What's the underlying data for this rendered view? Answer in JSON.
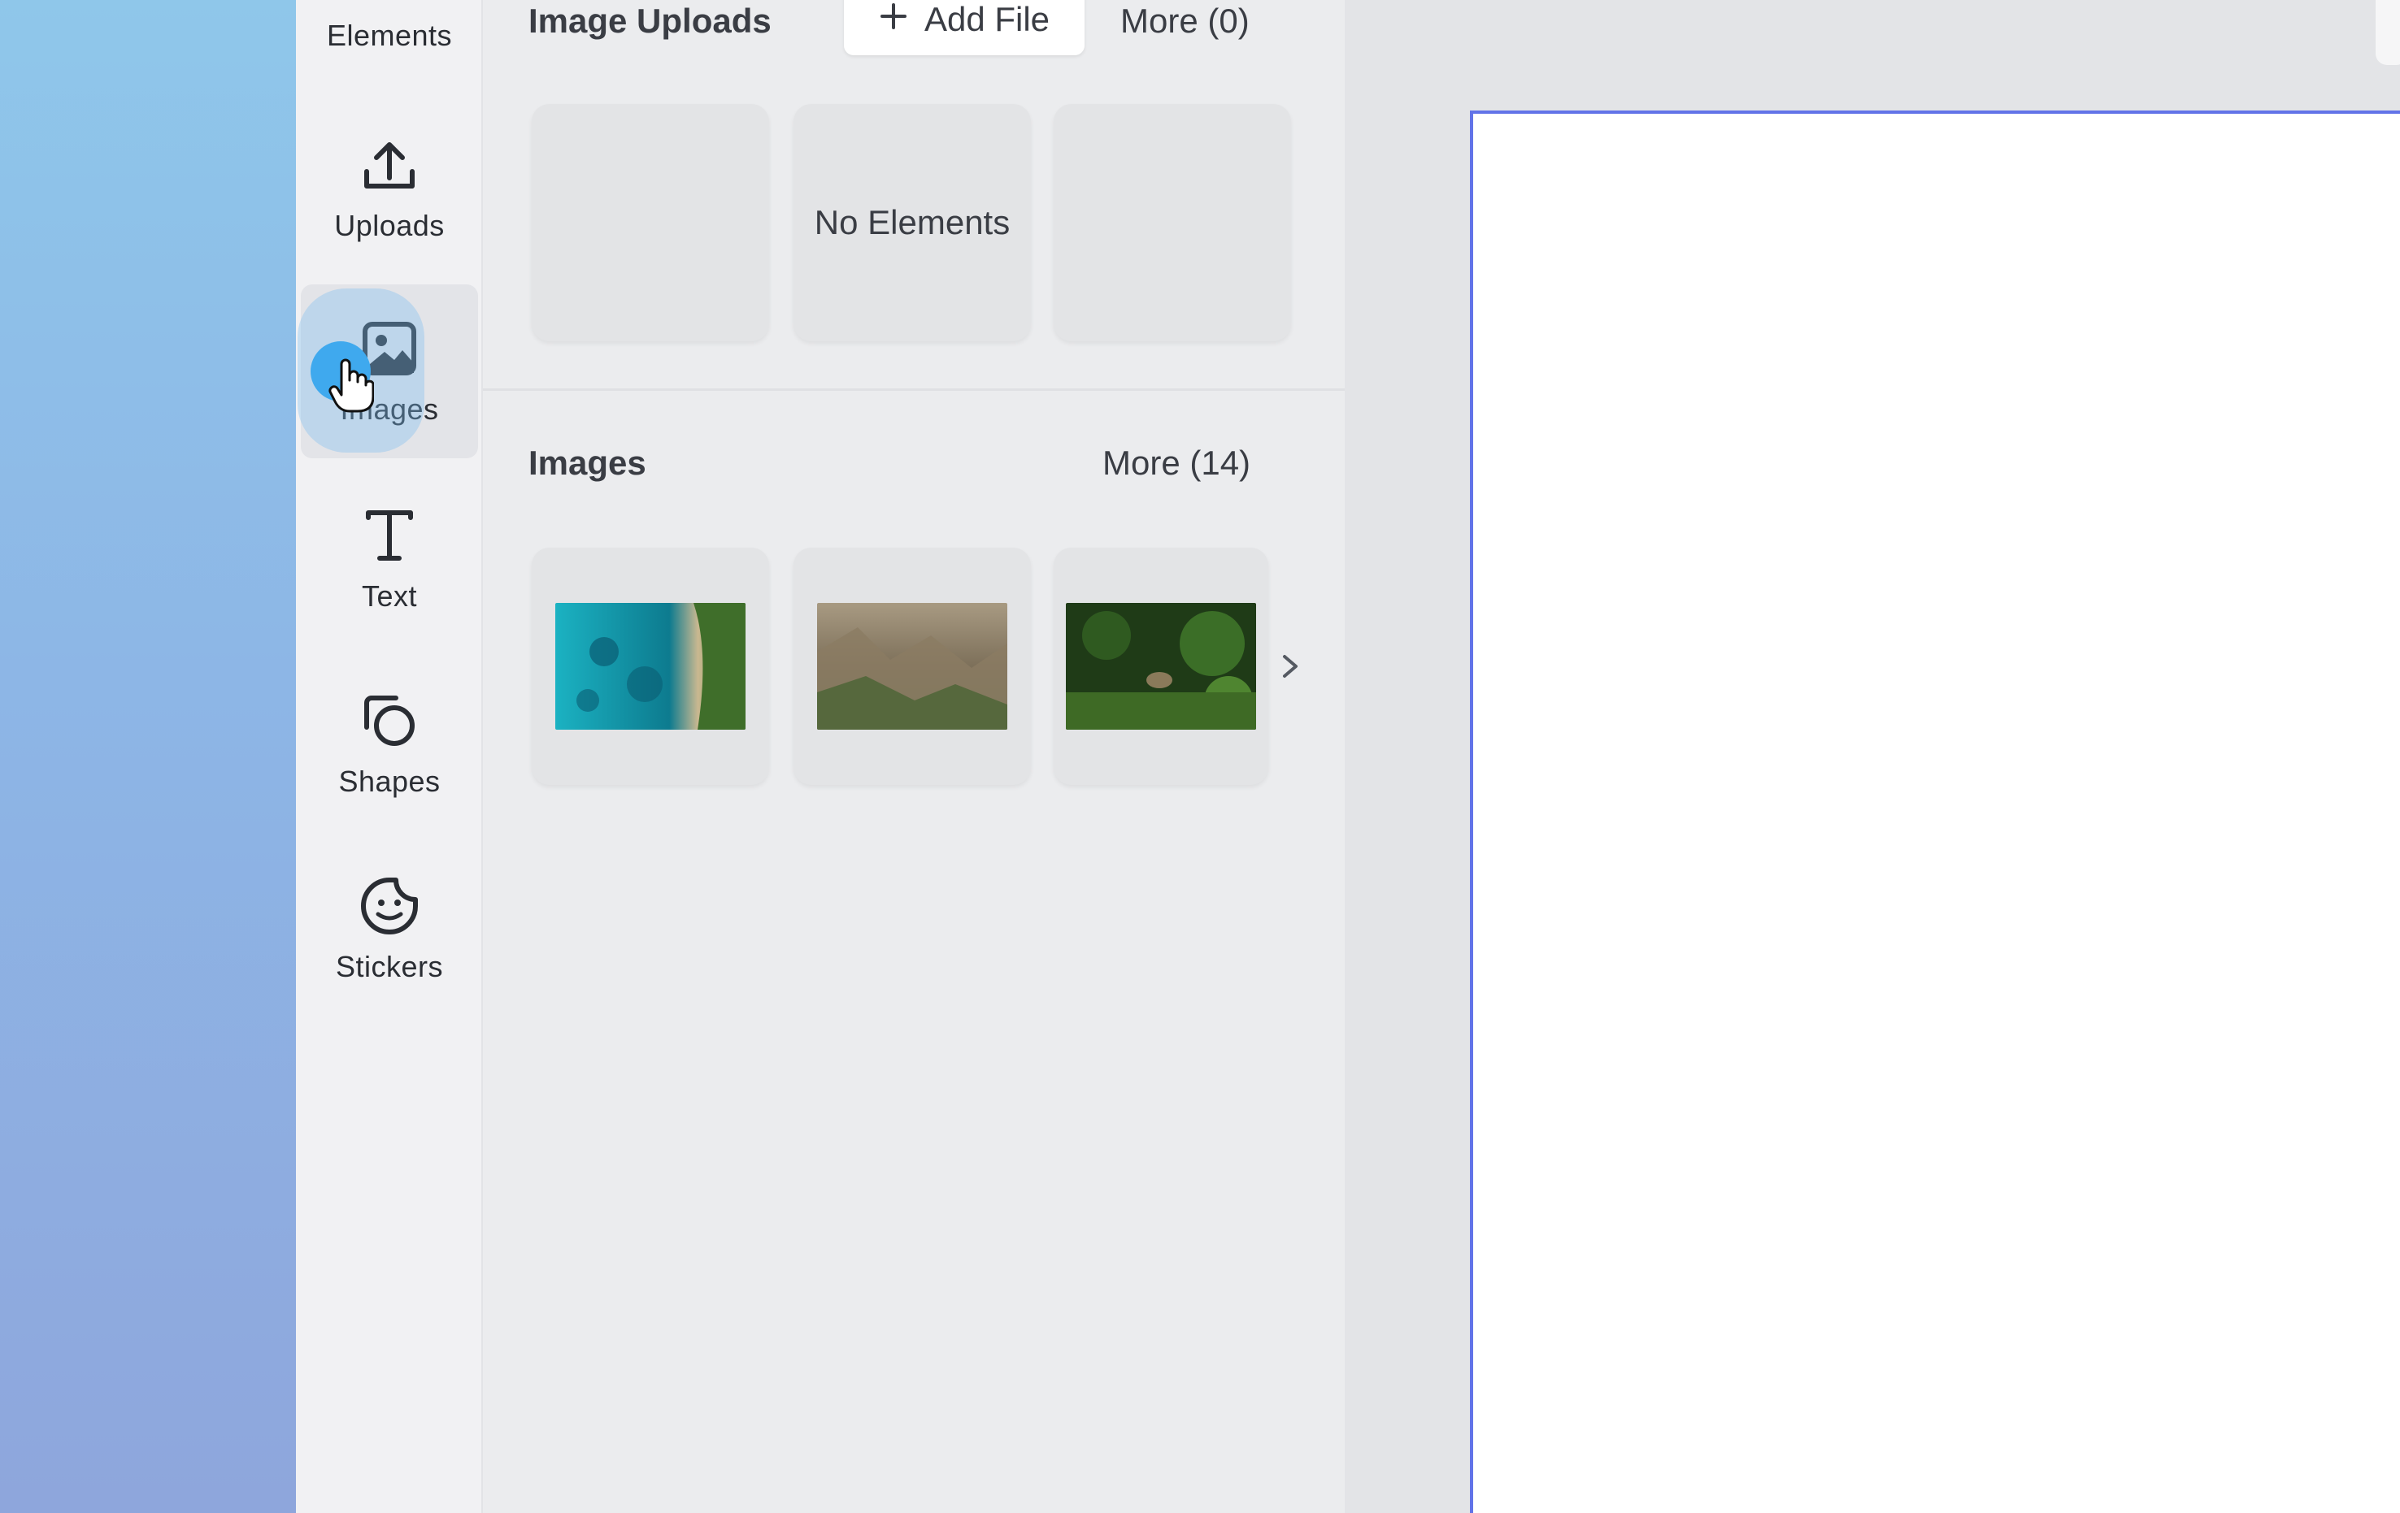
{
  "rail": {
    "items": [
      {
        "key": "elements",
        "label": "Elements",
        "icon": "elements-icon"
      },
      {
        "key": "uploads",
        "label": "Uploads",
        "icon": "upload-icon"
      },
      {
        "key": "images",
        "label": "Images",
        "icon": "image-icon",
        "active": true
      },
      {
        "key": "text",
        "label": "Text",
        "icon": "text-icon"
      },
      {
        "key": "shapes",
        "label": "Shapes",
        "icon": "shapes-icon"
      },
      {
        "key": "stickers",
        "label": "Stickers",
        "icon": "sticker-icon"
      }
    ]
  },
  "uploads_section": {
    "title": "Image Uploads",
    "add_file_label": "Add File",
    "more_label": "More (0)",
    "empty_text": "No Elements"
  },
  "images_section": {
    "title": "Images",
    "more_label": "More (14)",
    "thumbnails": [
      {
        "name": "coastline-aerial",
        "colors": [
          "#1aa6b5",
          "#0e6f86",
          "#5f8a3c"
        ]
      },
      {
        "name": "canyon-valley",
        "colors": [
          "#8b7a62",
          "#5e6b4f",
          "#a69579"
        ]
      },
      {
        "name": "forest-animal",
        "colors": [
          "#1f3d17",
          "#4f7a2c",
          "#2e5a1f"
        ]
      }
    ]
  },
  "colors": {
    "canvas_border": "#6273e8",
    "click_highlight": "#3fa9ee"
  }
}
